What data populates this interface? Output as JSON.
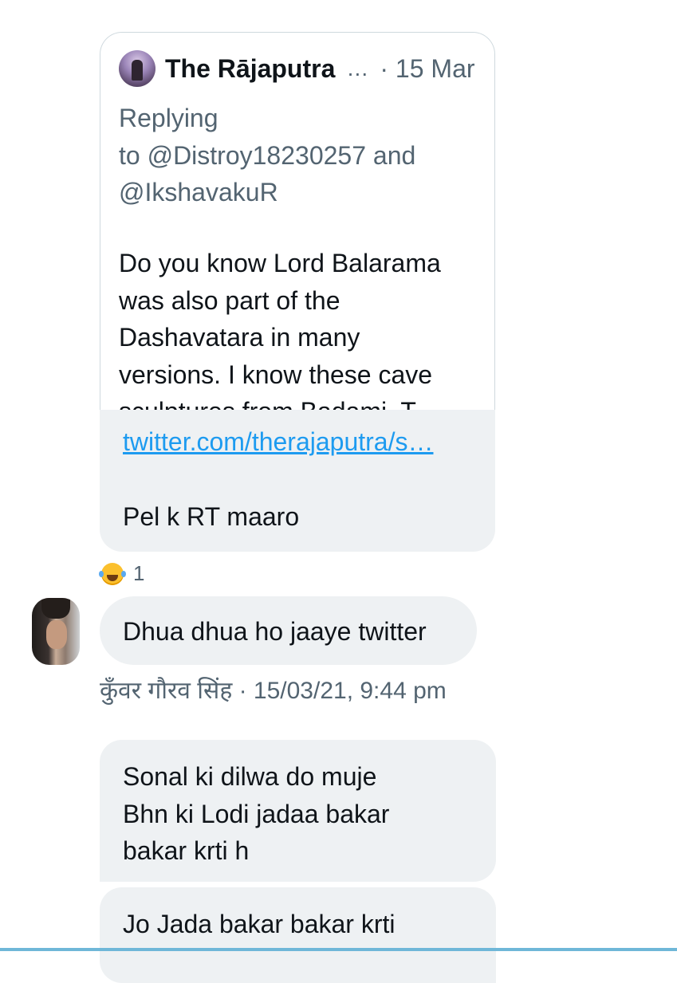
{
  "quoted_tweet": {
    "author_name": "The Rājaputra",
    "ellipsis": "…",
    "date": "· 15 Mar",
    "replying_prefix": "Replying",
    "replying_to": "to @Distroy18230257 and",
    "replying_to_2": "@IkshavakuR",
    "body_lines": [
      "Do you know Lord Balarama",
      "was also part of the",
      "Dashavatara in many",
      "versions. I know these cave",
      "sculptures from Badami. T…"
    ]
  },
  "link_message": {
    "link": "twitter.com/therajaputra/s…",
    "text": "Pel k RT maaro"
  },
  "reaction": {
    "emoji_icon": "laughing-tears-emoji",
    "count": "1"
  },
  "messages": [
    {
      "text": "Dhua dhua ho jaaye twitter",
      "sender": "कुँवर गौरव सिंह",
      "timestamp": "· 15/03/21, 9:44 pm"
    },
    {
      "lines": [
        "Sonal ki dilwa do muje",
        "Bhn ki Lodi jadaa bakar",
        "bakar krti h"
      ]
    },
    {
      "lines": [
        "Jo Jada bakar bakar krti"
      ]
    }
  ],
  "colors": {
    "bubble_bg": "#eef1f3",
    "link": "#1d9bf0",
    "muted": "#536471",
    "text": "#0f1419"
  }
}
